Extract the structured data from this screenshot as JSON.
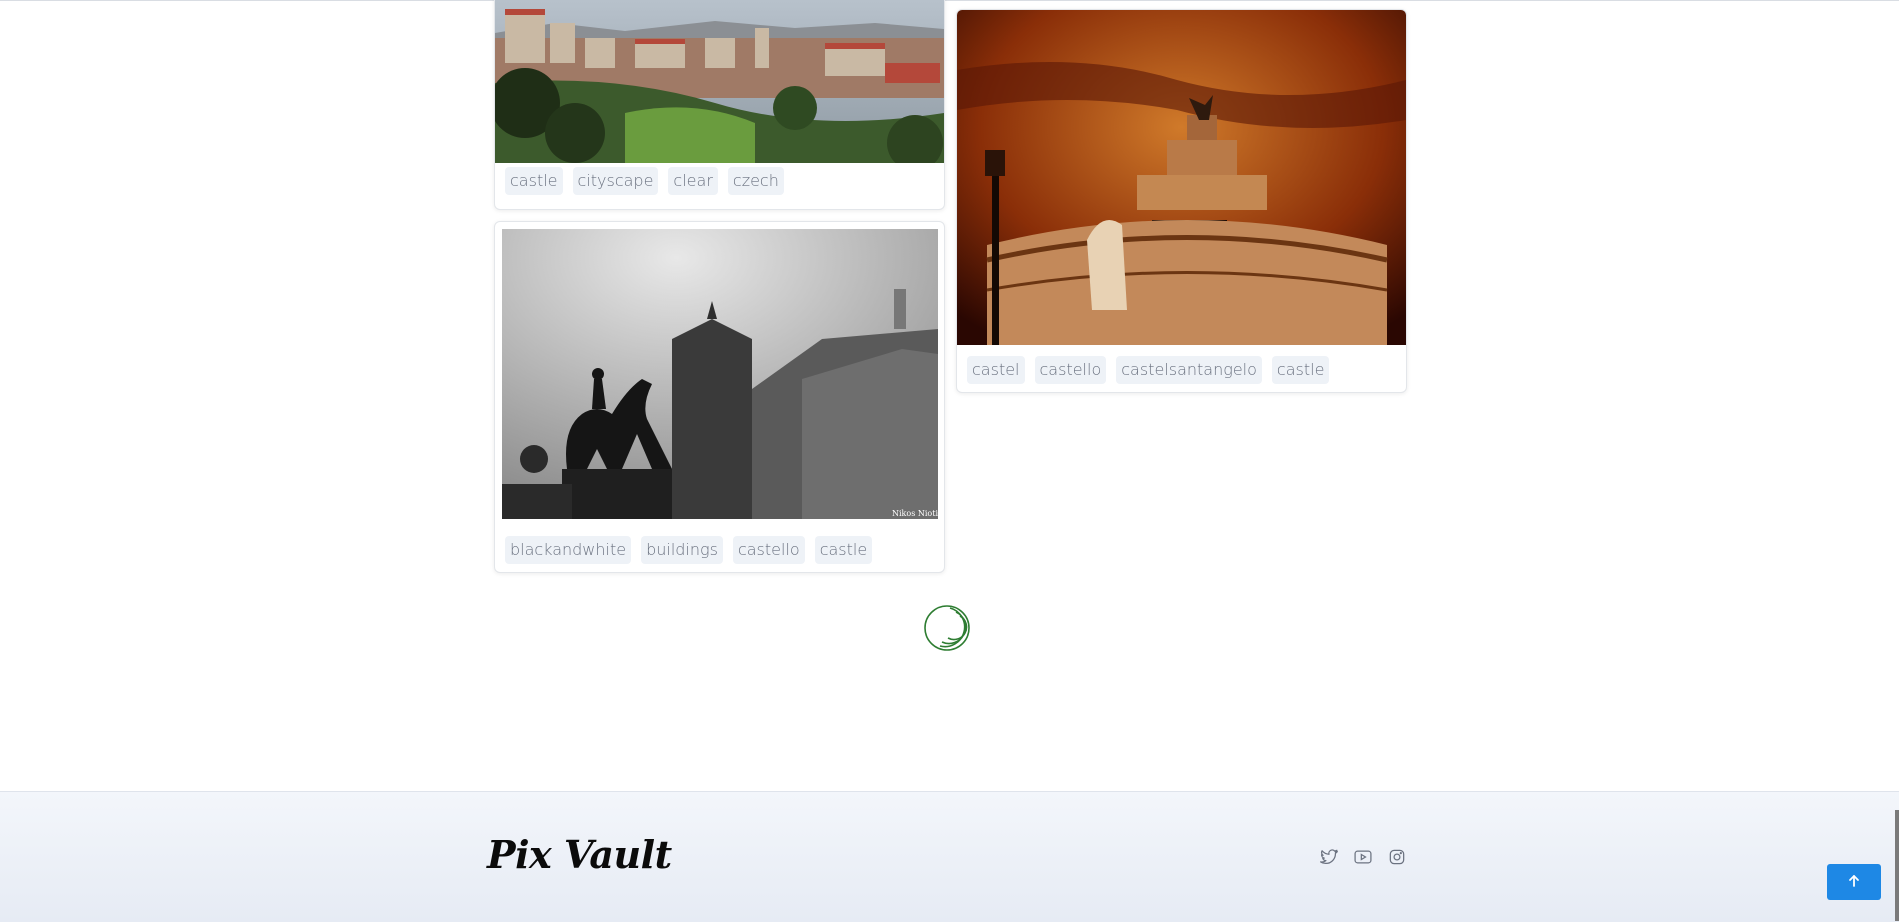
{
  "gallery": {
    "cards": [
      {
        "photo_alt": "Prague cityscape",
        "tags": [
          "castle",
          "cityscape",
          "clear",
          "czech"
        ]
      },
      {
        "photo_alt": "Equestrian statue and castle, black and white",
        "photo_credit": "Nikos Niotis",
        "tags": [
          "blackandwhite",
          "buildings",
          "castello",
          "castle"
        ]
      },
      {
        "photo_alt": "Castel Sant'Angelo at dramatic sunset",
        "tags": [
          "castel",
          "castello",
          "castelsantangelo",
          "castle"
        ]
      }
    ]
  },
  "loader": {
    "color": "#2e7d32"
  },
  "footer": {
    "brand": "Pix Vault",
    "social": [
      {
        "icon": "twitter-icon"
      },
      {
        "icon": "youtube-icon"
      },
      {
        "icon": "instagram-icon"
      }
    ]
  },
  "back_to_top": {
    "icon": "arrow-up-icon",
    "color": "#1e88e5"
  }
}
